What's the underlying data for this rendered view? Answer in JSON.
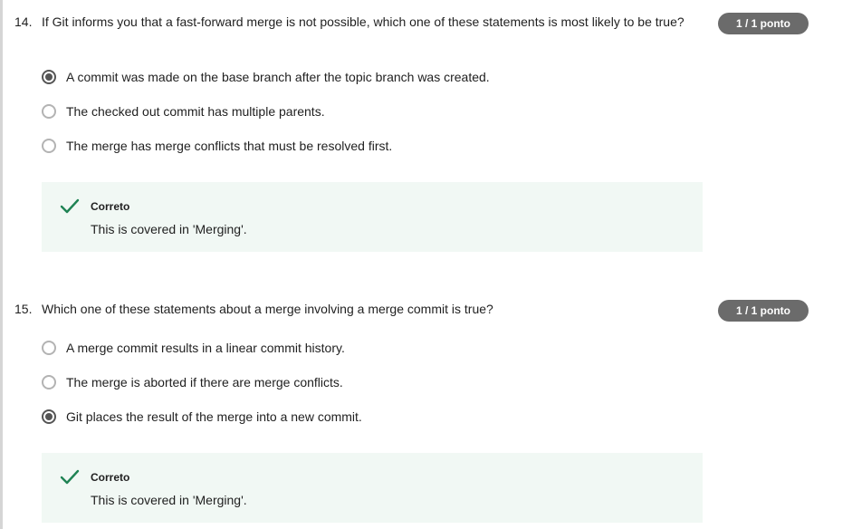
{
  "questions": [
    {
      "number": "14.",
      "text": "If Git informs you that a fast-forward merge is not possible, which one of these statements is most likely to be true?",
      "score": "1 / 1 ponto",
      "options": [
        {
          "label": "A commit was made on the base branch after the topic branch was created.",
          "selected": true
        },
        {
          "label": "The checked out commit has multiple parents.",
          "selected": false
        },
        {
          "label": "The merge has merge conflicts that must be resolved first.",
          "selected": false
        }
      ],
      "feedback": {
        "status": "Correto",
        "message": "This is covered in 'Merging'."
      }
    },
    {
      "number": "15.",
      "text": "Which one of these statements about a merge involving a merge commit is true?",
      "score": "1 / 1 ponto",
      "options": [
        {
          "label": "A merge commit results in a linear commit history.",
          "selected": false
        },
        {
          "label": "The merge is aborted if there are merge conflicts.",
          "selected": false
        },
        {
          "label": "Git places the result of the merge into a new commit.",
          "selected": true
        }
      ],
      "feedback": {
        "status": "Correto",
        "message": "This is covered in 'Merging'."
      }
    }
  ],
  "colors": {
    "badge_bg": "#6b6b6b",
    "feedback_bg": "#f1f8f4",
    "check_green": "#1f8354",
    "radio_selected": "#555555"
  },
  "icons": {
    "correct": "check-icon"
  }
}
